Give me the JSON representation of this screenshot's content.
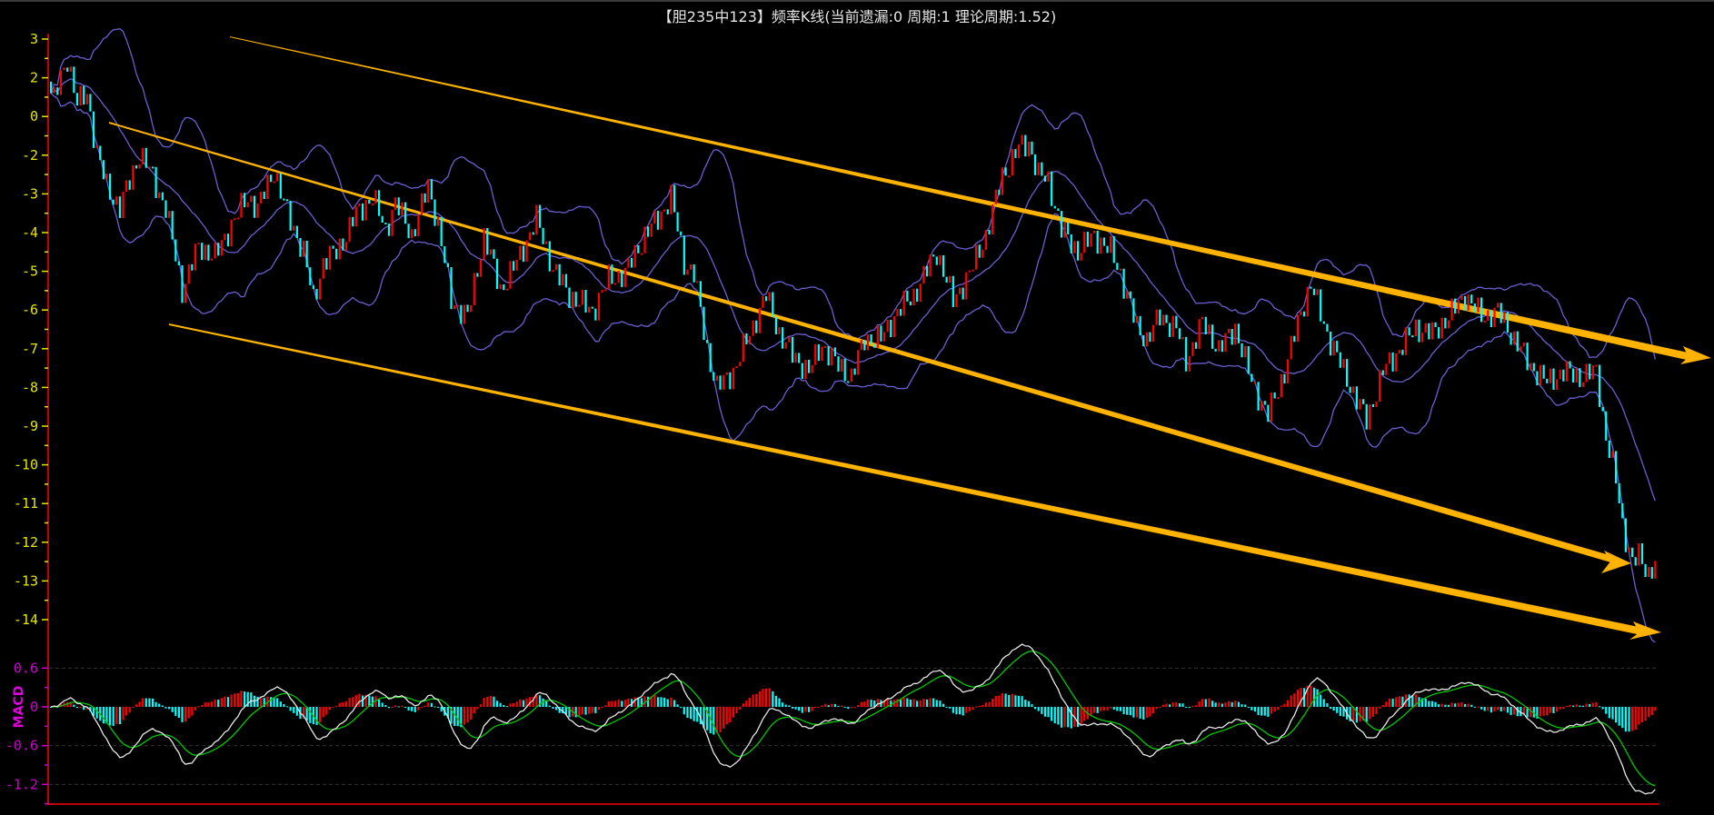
{
  "chart_data": {
    "type": "candlestick",
    "title": "【胆235中123】频率K线(当前遗漏:0 周期:1 理论周期:1.52)",
    "candle_count": 490,
    "price_path": [
      [
        0,
        -0.4
      ],
      [
        1,
        -0.55
      ],
      [
        5,
        0.52
      ],
      [
        8,
        -0.69
      ],
      [
        11,
        -0.41
      ],
      [
        14,
        -1.96
      ],
      [
        17,
        -2.8
      ],
      [
        21,
        -3.37
      ],
      [
        27,
        -1.96
      ],
      [
        30,
        -2.38
      ],
      [
        35,
        -3.37
      ],
      [
        40,
        -5.48
      ],
      [
        45,
        -4.35
      ],
      [
        50,
        -4.63
      ],
      [
        55,
        -3.79
      ],
      [
        60,
        -3.08
      ],
      [
        63,
        -3.37
      ],
      [
        68,
        -2.38
      ],
      [
        72,
        -3.51
      ],
      [
        77,
        -4.49
      ],
      [
        80,
        -5.76
      ],
      [
        83,
        -4.77
      ],
      [
        87,
        -4.49
      ],
      [
        90,
        -4.07
      ],
      [
        93,
        -3.51
      ],
      [
        98,
        -3.08
      ],
      [
        102,
        -3.93
      ],
      [
        105,
        -3.23
      ],
      [
        110,
        -4.07
      ],
      [
        115,
        -2.8
      ],
      [
        118,
        -3.79
      ],
      [
        122,
        -5.76
      ],
      [
        127,
        -6.18
      ],
      [
        132,
        -4.07
      ],
      [
        137,
        -5.48
      ],
      [
        142,
        -4.77
      ],
      [
        148,
        -3.65
      ],
      [
        153,
        -4.92
      ],
      [
        158,
        -5.62
      ],
      [
        165,
        -6.04
      ],
      [
        170,
        -5.2
      ],
      [
        175,
        -5.06
      ],
      [
        181,
        -4.07
      ],
      [
        185,
        -3.65
      ],
      [
        189,
        -3.08
      ],
      [
        193,
        -4.77
      ],
      [
        196,
        -5.06
      ],
      [
        200,
        -7.03
      ],
      [
        203,
        -8.01
      ],
      [
        208,
        -7.59
      ],
      [
        213,
        -6.61
      ],
      [
        218,
        -5.62
      ],
      [
        222,
        -6.61
      ],
      [
        226,
        -7.17
      ],
      [
        231,
        -7.59
      ],
      [
        235,
        -6.89
      ],
      [
        240,
        -7.45
      ],
      [
        244,
        -7.73
      ],
      [
        248,
        -6.75
      ],
      [
        253,
        -6.75
      ],
      [
        258,
        -6.04
      ],
      [
        263,
        -5.62
      ],
      [
        270,
        -4.49
      ],
      [
        275,
        -5.76
      ],
      [
        280,
        -5.06
      ],
      [
        285,
        -4.07
      ],
      [
        290,
        -2.52
      ],
      [
        295,
        -1.82
      ],
      [
        298,
        -1.68
      ],
      [
        301,
        -2.52
      ],
      [
        304,
        -2.66
      ],
      [
        308,
        -3.93
      ],
      [
        313,
        -4.49
      ],
      [
        318,
        -4.07
      ],
      [
        323,
        -4.49
      ],
      [
        326,
        -5.06
      ],
      [
        331,
        -6.46
      ],
      [
        334,
        -6.75
      ],
      [
        338,
        -6.18
      ],
      [
        343,
        -6.46
      ],
      [
        346,
        -7.31
      ],
      [
        351,
        -6.32
      ],
      [
        356,
        -7.03
      ],
      [
        361,
        -6.46
      ],
      [
        366,
        -7.87
      ],
      [
        371,
        -8.72
      ],
      [
        376,
        -7.59
      ],
      [
        381,
        -6.04
      ],
      [
        384,
        -5.34
      ],
      [
        389,
        -6.61
      ],
      [
        394,
        -7.59
      ],
      [
        401,
        -8.86
      ],
      [
        406,
        -7.59
      ],
      [
        411,
        -7.03
      ],
      [
        416,
        -6.46
      ],
      [
        421,
        -6.61
      ],
      [
        426,
        -6.18
      ],
      [
        431,
        -5.62
      ],
      [
        436,
        -6.18
      ],
      [
        441,
        -6.04
      ],
      [
        446,
        -6.75
      ],
      [
        451,
        -7.45
      ],
      [
        456,
        -7.87
      ],
      [
        461,
        -7.59
      ],
      [
        466,
        -7.73
      ],
      [
        471,
        -7.59
      ],
      [
        474,
        -9.28
      ],
      [
        477,
        -10.41
      ],
      [
        479,
        -11.54
      ],
      [
        482,
        -12.52
      ],
      [
        484,
        -12.38
      ],
      [
        487,
        -12.8
      ],
      [
        489,
        -12.52
      ]
    ],
    "y_ticks": [
      {
        "v": 1,
        "label": "3"
      },
      {
        "v": 0,
        "label": "2"
      },
      {
        "v": -1,
        "label": "0"
      },
      {
        "v": -2,
        "label": "-2"
      },
      {
        "v": -3,
        "label": "-3"
      },
      {
        "v": -4,
        "label": "-4"
      },
      {
        "v": -5,
        "label": "-5"
      },
      {
        "v": -6,
        "label": "-6"
      },
      {
        "v": -7,
        "label": "-7"
      },
      {
        "v": -8,
        "label": "-8"
      },
      {
        "v": -9,
        "label": "-9"
      },
      {
        "v": -10,
        "label": "-10"
      },
      {
        "v": -11,
        "label": "-11"
      },
      {
        "v": -12,
        "label": "-12"
      },
      {
        "v": -13,
        "label": "-13"
      },
      {
        "v": -14,
        "label": "-14"
      }
    ],
    "indicators": [
      "Bollinger Bands",
      "MACD"
    ],
    "macd": {
      "label": "MACD",
      "y_ticks": [
        {
          "v": 0.6,
          "label": "0.6"
        },
        {
          "v": 0,
          "label": "0"
        },
        {
          "v": -0.6,
          "label": "-0.6"
        },
        {
          "v": -1.2,
          "label": "-1.2"
        }
      ],
      "ylim": [
        -1.45,
        0.75
      ]
    },
    "colors": {
      "up": "#ff0000",
      "down": "#00ffff",
      "band": "#6a5fd0",
      "trend": "#ffb300",
      "dif": "#e8e8e8",
      "dea": "#00c800",
      "axis": "#c00000",
      "price_label": "#e6e600",
      "macd_label": "#d000d0"
    }
  }
}
